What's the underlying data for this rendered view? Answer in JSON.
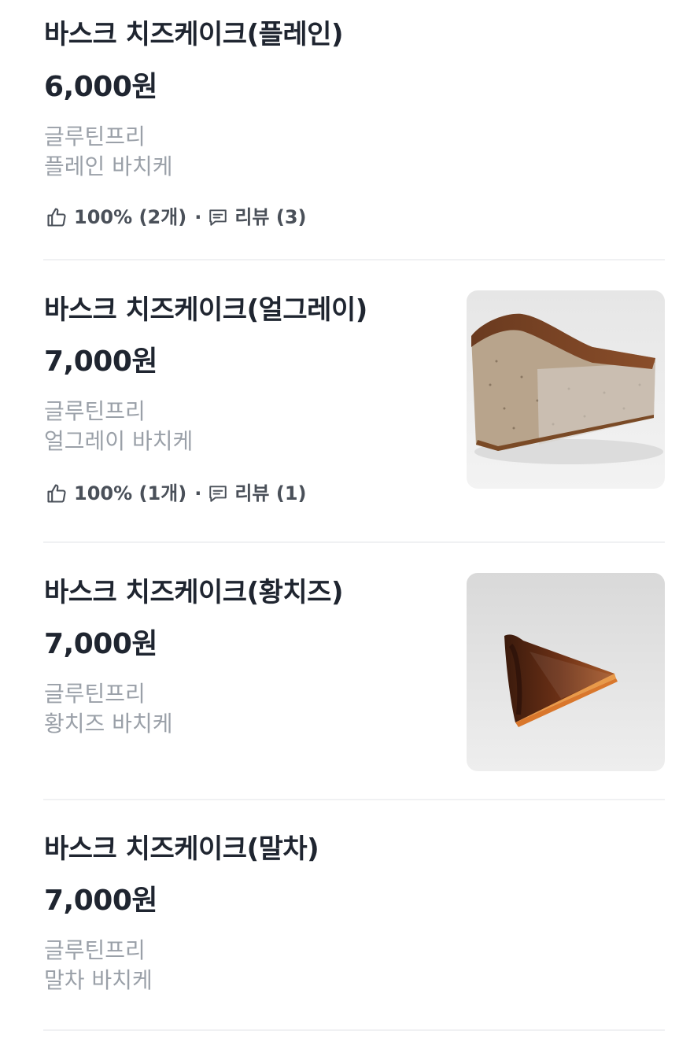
{
  "items": [
    {
      "title": "바스크 치즈케이크(플레인)",
      "price": "6,000원",
      "tag": "글루틴프리",
      "desc": "플레인 바치케",
      "rating": "100% (2개)",
      "review": "리뷰 (3)"
    },
    {
      "title": "바스크 치즈케이크(얼그레이)",
      "price": "7,000원",
      "tag": "글루틴프리",
      "desc": "얼그레이 바치케",
      "rating": "100% (1개)",
      "review": "리뷰 (1)",
      "image": "earl-grey-cheesecake-slice-photo"
    },
    {
      "title": "바스크 치즈케이크(황치즈)",
      "price": "7,000원",
      "tag": "글루틴프리",
      "desc": "황치즈 바치케",
      "image": "yellow-cheese-cheesecake-slice-photo"
    },
    {
      "title": "바스크 치즈케이크(말차)",
      "price": "7,000원",
      "tag": "글루틴프리",
      "desc": "말차 바치케"
    }
  ],
  "icons": {
    "like": "thumbs-up-icon",
    "review": "speech-bubble-icon"
  },
  "colors": {
    "title": "#1f2530",
    "description": "#9aa0a8",
    "meta": "#4a5059",
    "divider": "#f0f1f3"
  }
}
